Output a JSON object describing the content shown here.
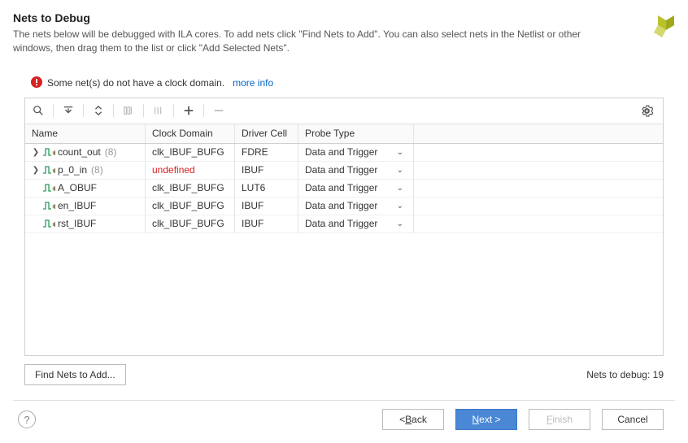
{
  "header": {
    "title": "Nets to Debug",
    "subtitle": "The nets below will be debugged with ILA cores. To add nets click \"Find Nets to Add\". You can also select nets in the Netlist or other windows, then drag them to the list or click \"Add Selected Nets\"."
  },
  "warning": {
    "text": "Some net(s) do not have a clock domain.",
    "link": "more info"
  },
  "columns": {
    "name": "Name",
    "clock": "Clock Domain",
    "driver": "Driver Cell",
    "probe": "Probe Type"
  },
  "rows": [
    {
      "expandable": true,
      "name": "count_out",
      "count": "(8)",
      "clock": "clk_IBUF_BUFG",
      "driver": "FDRE",
      "probe": "Data and Trigger"
    },
    {
      "expandable": true,
      "name": "p_0_in",
      "count": "(8)",
      "clock": "undefined",
      "clock_undef": true,
      "driver": "IBUF",
      "probe": "Data and Trigger"
    },
    {
      "expandable": false,
      "name": "A_OBUF",
      "clock": "clk_IBUF_BUFG",
      "driver": "LUT6",
      "probe": "Data and Trigger"
    },
    {
      "expandable": false,
      "name": "en_IBUF",
      "clock": "clk_IBUF_BUFG",
      "driver": "IBUF",
      "probe": "Data and Trigger"
    },
    {
      "expandable": false,
      "name": "rst_IBUF",
      "clock": "clk_IBUF_BUFG",
      "driver": "IBUF",
      "probe": "Data and Trigger"
    }
  ],
  "footer": {
    "find": "Find Nets to Add...",
    "count_label": "Nets to debug: ",
    "count_value": "19"
  },
  "buttons": {
    "back": "< Back",
    "next": "Next >",
    "finish": "Finish",
    "cancel": "Cancel"
  }
}
